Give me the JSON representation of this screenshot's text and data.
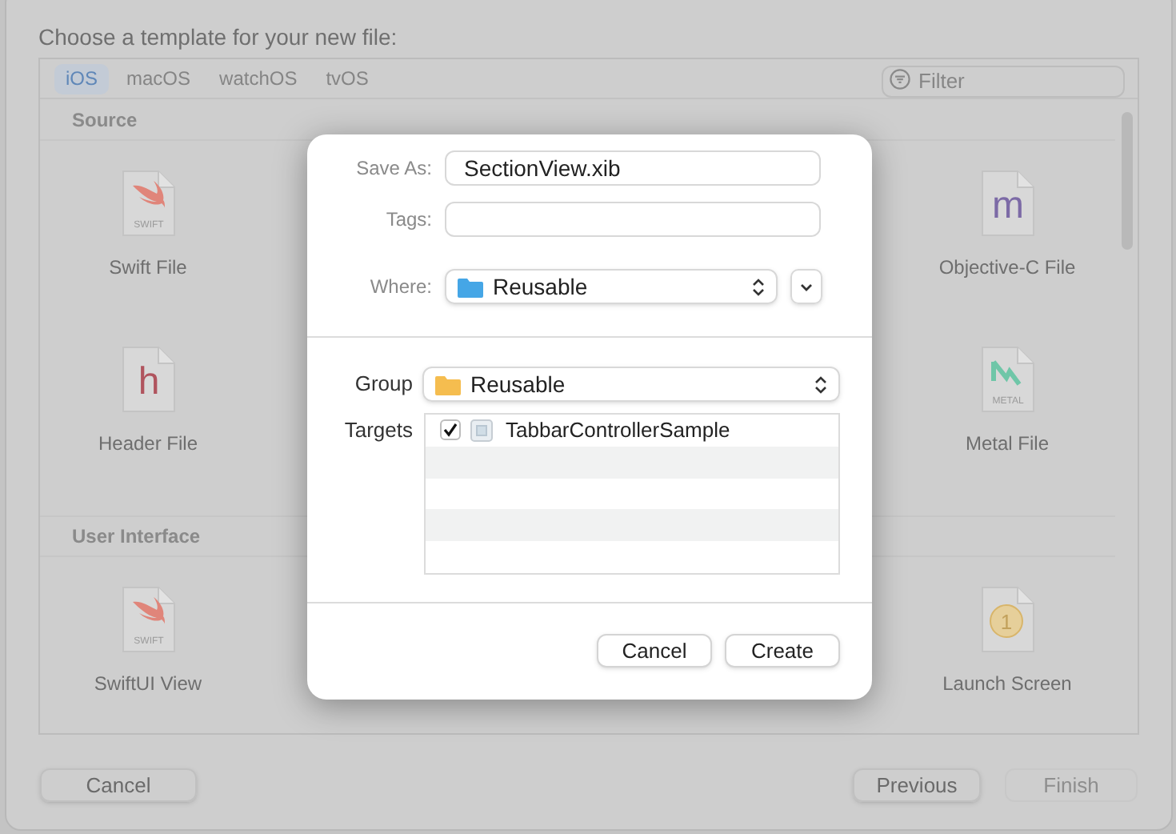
{
  "window": {
    "title": "Choose a template for your new file:"
  },
  "platform_tabs": [
    {
      "label": "iOS",
      "selected": true
    },
    {
      "label": "macOS",
      "selected": false
    },
    {
      "label": "watchOS",
      "selected": false
    },
    {
      "label": "tvOS",
      "selected": false
    }
  ],
  "filter": {
    "placeholder": "Filter"
  },
  "sections": [
    {
      "title": "Source",
      "rows": [
        {
          "left": {
            "name": "Swift File",
            "kind": "swift",
            "icon_text": "SWIFT"
          },
          "right": {
            "name": "Objective-C File",
            "kind": "letter",
            "icon_text": "m",
            "color": "#7c6aa6"
          }
        },
        {
          "left": {
            "name": "Header File",
            "kind": "letter",
            "icon_text": "h",
            "color": "#b0545e"
          },
          "right": {
            "name": "Metal File",
            "kind": "metal",
            "icon_text": "METAL"
          }
        }
      ]
    },
    {
      "title": "User Interface",
      "rows": [
        {
          "left": {
            "name": "SwiftUI View",
            "kind": "swift",
            "icon_text": "SWIFT"
          },
          "right": {
            "name": "Launch Screen",
            "kind": "launch",
            "icon_text": "1"
          }
        }
      ]
    }
  ],
  "save_dialog": {
    "save_as": {
      "label": "Save As:",
      "value": "SectionView.xib"
    },
    "tags": {
      "label": "Tags:"
    },
    "where": {
      "label": "Where:",
      "value": "Reusable"
    },
    "group": {
      "label": "Group",
      "value": "Reusable"
    },
    "targets": {
      "label": "Targets",
      "items": [
        {
          "name": "TabbarControllerSample",
          "checked": true
        }
      ]
    },
    "buttons": [
      {
        "label": "Cancel"
      },
      {
        "label": "Create"
      }
    ]
  },
  "footer_buttons": [
    {
      "label": "Cancel",
      "disabled": false
    },
    {
      "label": "Previous",
      "disabled": false
    },
    {
      "label": "Finish",
      "disabled": true
    }
  ]
}
